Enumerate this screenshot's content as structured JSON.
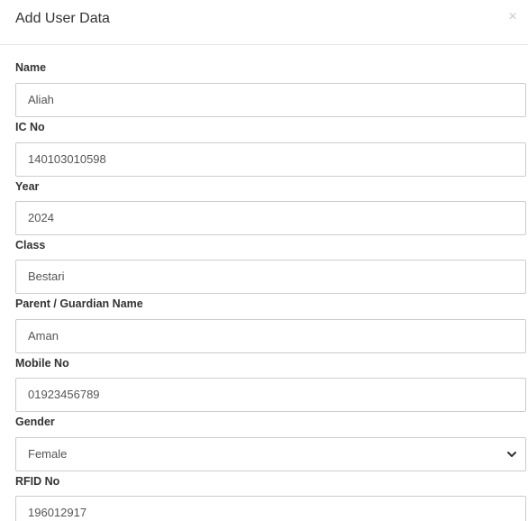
{
  "modal": {
    "title": "Add User Data",
    "close_symbol": "×"
  },
  "form": {
    "name": {
      "label": "Name",
      "value": "Aliah"
    },
    "ic_no": {
      "label": "IC No",
      "value": "140103010598"
    },
    "year": {
      "label": "Year",
      "value": "2024"
    },
    "class": {
      "label": "Class",
      "value": "Bestari"
    },
    "parent_guardian": {
      "label": "Parent / Guardian Name",
      "value": "Aman"
    },
    "mobile_no": {
      "label": "Mobile No",
      "value": "01923456789"
    },
    "gender": {
      "label": "Gender",
      "value": "Female"
    },
    "rfid_no": {
      "label": "RFID No",
      "value": "196012917"
    }
  },
  "icons": {
    "close": "close-icon",
    "select_arrow": "chevron-down-icon"
  }
}
